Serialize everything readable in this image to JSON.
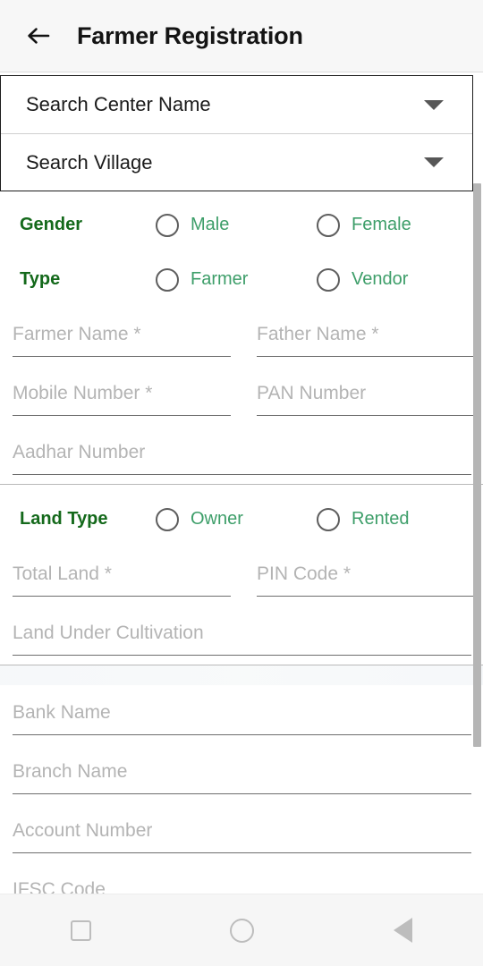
{
  "appbar": {
    "back_icon": "arrow-left-icon",
    "title": "Farmer Registration"
  },
  "dropdowns": [
    {
      "label": "Search Center Name",
      "icon": "chevron-down-icon"
    },
    {
      "label": "Search Village",
      "icon": "chevron-down-icon"
    }
  ],
  "form": {
    "personal_section": {
      "radio_groups": [
        {
          "label": "Gender",
          "options": [
            {
              "label": "Male",
              "selected": false
            },
            {
              "label": "Female",
              "selected": false
            }
          ]
        },
        {
          "label": "Type",
          "options": [
            {
              "label": "Farmer",
              "selected": false
            },
            {
              "label": "Vendor",
              "selected": false
            }
          ]
        }
      ],
      "fields": [
        {
          "placeholder": "Farmer Name *",
          "value": "",
          "width": "half"
        },
        {
          "placeholder": "Father Name *",
          "value": "",
          "width": "half"
        },
        {
          "placeholder": "Mobile Number *",
          "value": "",
          "width": "half"
        },
        {
          "placeholder": "PAN Number",
          "value": "",
          "width": "half"
        },
        {
          "placeholder": "Aadhar Number",
          "value": "",
          "width": "full"
        }
      ]
    },
    "land_section": {
      "radio_groups": [
        {
          "label": "Land Type",
          "options": [
            {
              "label": "Owner",
              "selected": false
            },
            {
              "label": "Rented",
              "selected": false
            }
          ]
        }
      ],
      "fields": [
        {
          "placeholder": "Total Land *",
          "value": "",
          "width": "half"
        },
        {
          "placeholder": "PIN Code *",
          "value": "",
          "width": "half"
        },
        {
          "placeholder": "Land Under Cultivation",
          "value": "",
          "width": "full"
        }
      ]
    },
    "bank_section": {
      "fields": [
        {
          "placeholder": "Bank Name",
          "value": "",
          "width": "full"
        },
        {
          "placeholder": "Branch Name",
          "value": "",
          "width": "full"
        },
        {
          "placeholder": "Account Number",
          "value": "",
          "width": "full"
        },
        {
          "placeholder": "IFSC Code",
          "value": "",
          "width": "full"
        }
      ]
    }
  },
  "navbar": {
    "recents": "square-icon",
    "home": "circle-icon",
    "back": "triangle-back-icon"
  },
  "colors": {
    "group_label_green": "#14691b",
    "option_green": "#3d9e69",
    "placeholder_gray": "#b4b4b4",
    "underline_gray": "#6e6e6e",
    "appbar_bg": "#f7f7f7",
    "navbar_bg": "#f6f6f6"
  }
}
